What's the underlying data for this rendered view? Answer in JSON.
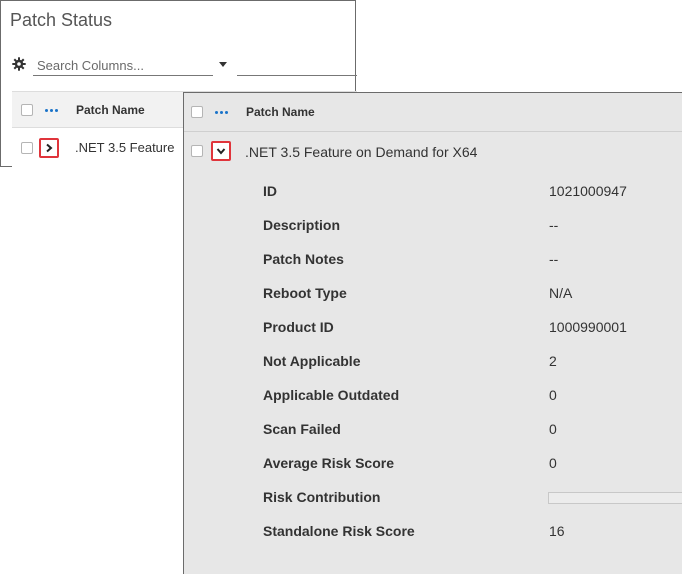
{
  "patch_status": {
    "title": "Patch Status",
    "search": {
      "placeholder": "Search Columns..."
    },
    "table": {
      "column_header": "Patch Name",
      "row": {
        "patch_name": ".NET 3.5 Feature"
      }
    }
  },
  "expanded_view": {
    "column_header": "Patch Name",
    "row": {
      "patch_name": ".NET 3.5 Feature on Demand for X64"
    },
    "details": [
      {
        "label": "ID",
        "value": "1021000947"
      },
      {
        "label": "Description",
        "value": "--"
      },
      {
        "label": "Patch Notes",
        "value": "--"
      },
      {
        "label": "Reboot Type",
        "value": "N/A"
      },
      {
        "label": "Product ID",
        "value": "1000990001"
      },
      {
        "label": "Not Applicable",
        "value": "2"
      },
      {
        "label": "Applicable Outdated",
        "value": "0"
      },
      {
        "label": "Scan Failed",
        "value": "0"
      },
      {
        "label": "Average Risk Score",
        "value": "0"
      },
      {
        "label": "Risk Contribution",
        "value": "",
        "bar_fraction": 0
      },
      {
        "label": "Standalone Risk Score",
        "value": "16"
      }
    ]
  },
  "colors": {
    "accent_blue": "#1a73c9",
    "highlight_red": "#e0343b",
    "detail_background": "#e7e7e7"
  },
  "icons": {
    "settings": "gear-icon",
    "dropdown": "caret-down-icon",
    "column_menu": "more-dots-icon",
    "collapsed": "chevron-right-icon",
    "expanded": "chevron-down-icon"
  }
}
